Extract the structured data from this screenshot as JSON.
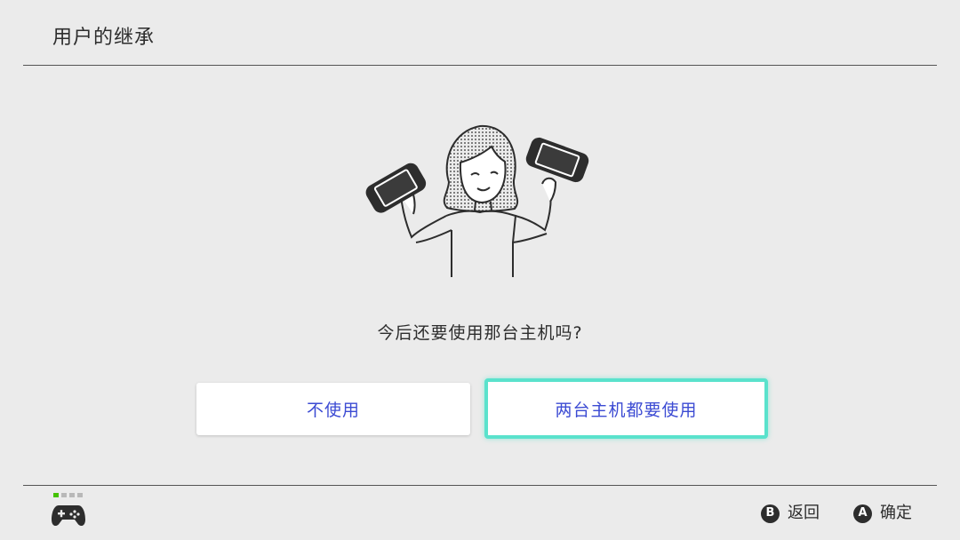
{
  "header": {
    "title": "用户的继承"
  },
  "main": {
    "question": "今后还要使用那台主机吗?",
    "buttons": {
      "no_label": "不使用",
      "both_label": "两台主机都要使用"
    }
  },
  "footer": {
    "controller_slots": {
      "active": 1,
      "total": 4
    },
    "hints": [
      {
        "glyph": "B",
        "label": "返回"
      },
      {
        "glyph": "A",
        "label": "确定"
      }
    ]
  },
  "colors": {
    "background": "#ebebeb",
    "button_text": "#3c4bd3",
    "focus_border": "#5ae2cc",
    "player_indicator_active": "#44c200"
  }
}
